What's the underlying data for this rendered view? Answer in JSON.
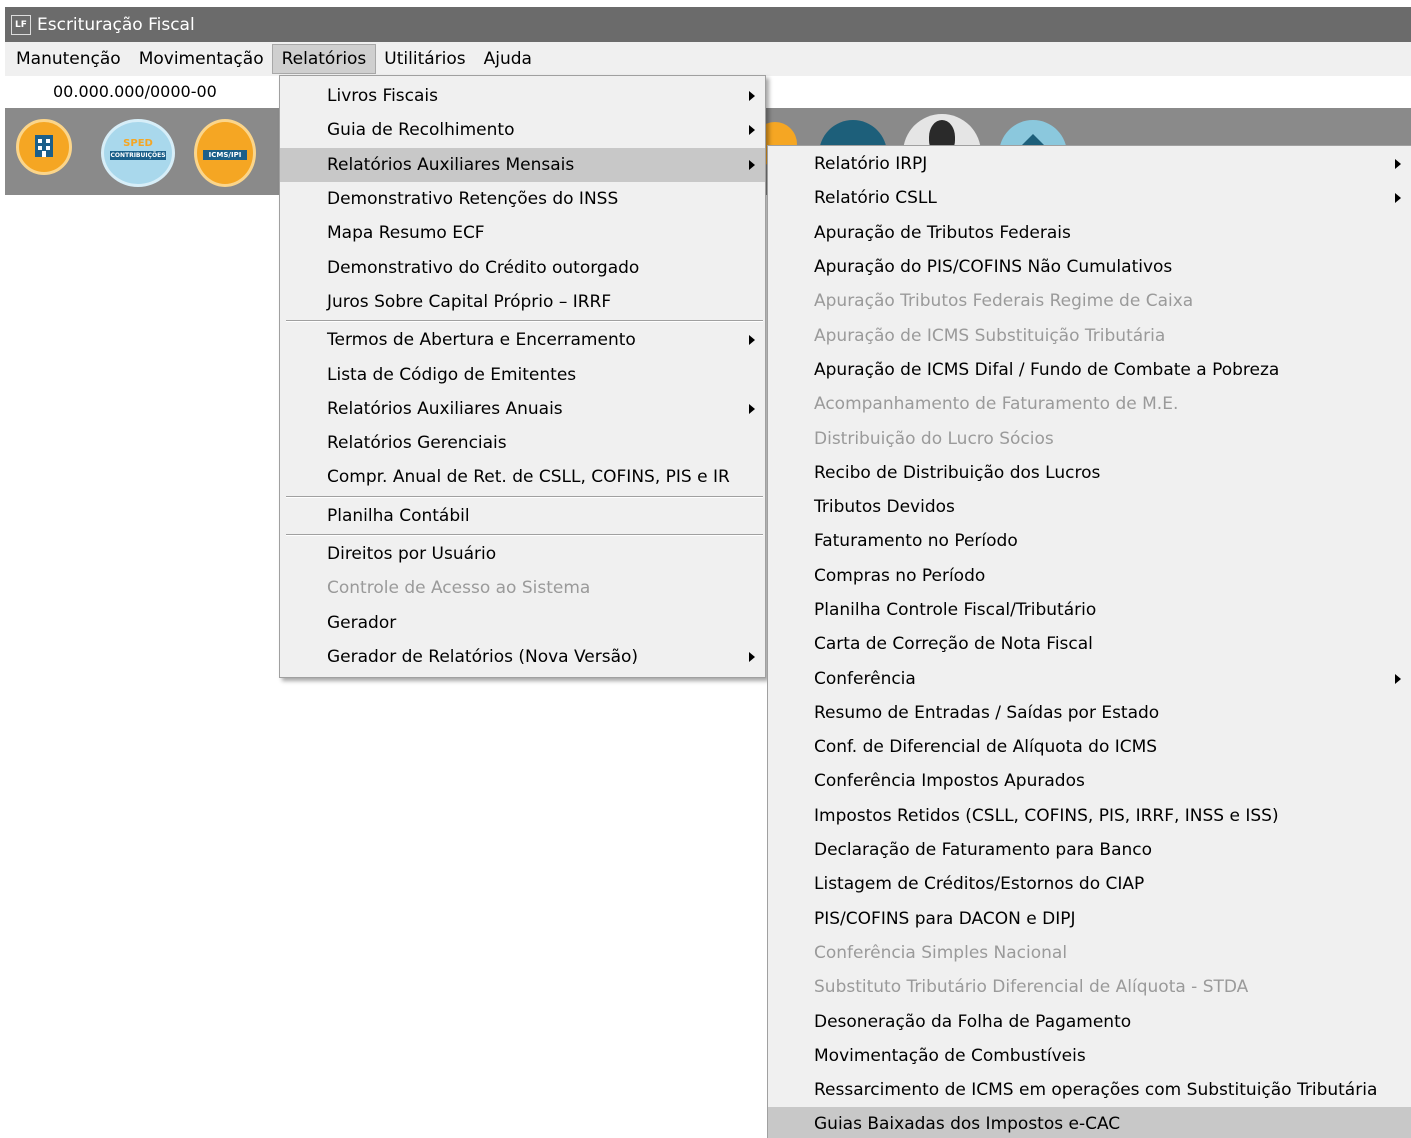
{
  "window": {
    "title": "Escrituração Fiscal",
    "icon_label": "LF"
  },
  "menubar": {
    "items": [
      "Manutenção",
      "Movimentação",
      "Relatórios",
      "Utilitários",
      "Ajuda"
    ],
    "active": "Relatórios"
  },
  "company": {
    "cnpj": "00.000.000/0000-00"
  },
  "toolbar": {
    "icons": [
      {
        "name": "building-icon",
        "color": "#f5a623"
      },
      {
        "name": "sped-contribuicoes-icon",
        "color": "#a9d8ec",
        "lines": [
          "SPED",
          "CONTRIBUIÇÕES"
        ]
      },
      {
        "name": "icms-ipi-icon",
        "color": "#f5a623",
        "label": "ICMS/IPI"
      }
    ]
  },
  "relatorios_menu": {
    "items": [
      {
        "label": "Livros Fiscais",
        "submenu": true
      },
      {
        "label": "Guia de Recolhimento",
        "submenu": true
      },
      {
        "label": "Relatórios Auxiliares Mensais",
        "submenu": true,
        "highlight": true
      },
      {
        "label": "Demonstrativo Retenções do INSS"
      },
      {
        "label": "Mapa Resumo ECF"
      },
      {
        "label": "Demonstrativo do Crédito outorgado"
      },
      {
        "label": "Juros Sobre Capital Próprio – IRRF"
      },
      {
        "separator": true
      },
      {
        "label": "Termos de Abertura e Encerramento",
        "submenu": true
      },
      {
        "label": "Lista de Código de Emitentes"
      },
      {
        "label": "Relatórios Auxiliares Anuais",
        "submenu": true
      },
      {
        "label": "Relatórios Gerenciais"
      },
      {
        "label": "Compr. Anual de Ret. de CSLL, COFINS,  PIS e IR"
      },
      {
        "separator": true
      },
      {
        "label": "Planilha Contábil"
      },
      {
        "separator": true
      },
      {
        "label": "Direitos por Usuário"
      },
      {
        "label": "Controle de Acesso ao Sistema",
        "disabled": true
      },
      {
        "label": "Gerador"
      },
      {
        "label": "Gerador de Relatórios (Nova Versão)",
        "submenu": true
      }
    ]
  },
  "mensais_submenu": {
    "items": [
      {
        "label": "Relatório IRPJ",
        "submenu": true
      },
      {
        "label": "Relatório CSLL",
        "submenu": true
      },
      {
        "label": "Apuração de Tributos Federais"
      },
      {
        "label": "Apuração do PIS/COFINS Não Cumulativos"
      },
      {
        "label": "Apuração Tributos Federais Regime de Caixa",
        "disabled": true
      },
      {
        "label": "Apuração de ICMS Substituição Tributária",
        "disabled": true
      },
      {
        "label": "Apuração de ICMS Difal / Fundo de Combate a Pobreza"
      },
      {
        "label": "Acompanhamento de Faturamento de M.E.",
        "disabled": true
      },
      {
        "label": "Distribuição do Lucro Sócios",
        "disabled": true
      },
      {
        "label": "Recibo de Distribuição dos Lucros"
      },
      {
        "label": "Tributos Devidos"
      },
      {
        "label": "Faturamento no Período"
      },
      {
        "label": "Compras no Período"
      },
      {
        "label": "Planilha Controle Fiscal/Tributário"
      },
      {
        "label": "Carta de Correção de Nota Fiscal"
      },
      {
        "label": "Conferência",
        "submenu": true
      },
      {
        "label": "Resumo de Entradas / Saídas por Estado"
      },
      {
        "label": "Conf. de Diferencial de Alíquota do ICMS"
      },
      {
        "label": "Conferência Impostos Apurados"
      },
      {
        "label": "Impostos Retidos (CSLL, COFINS,  PIS, IRRF, INSS e ISS)"
      },
      {
        "label": "Declaração de Faturamento para Banco"
      },
      {
        "label": "Listagem de Créditos/Estornos do CIAP"
      },
      {
        "label": "PIS/COFINS para DACON e DIPJ"
      },
      {
        "label": "Conferência Simples Nacional",
        "disabled": true
      },
      {
        "label": "Substituto Tributário Diferencial de Alíquota - STDA",
        "disabled": true
      },
      {
        "label": "Desoneração da Folha de Pagamento"
      },
      {
        "label": "Movimentação de Combustíveis"
      },
      {
        "label": "Ressarcimento de ICMS em operações com Substituição Tributária"
      },
      {
        "label": "Guias Baixadas dos Impostos e-CAC",
        "highlight": true
      }
    ]
  }
}
